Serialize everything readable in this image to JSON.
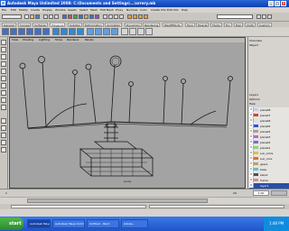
{
  "window": {
    "title": "Autodesk Maya Unlimited 2008: C:\\Documents and Settings\\...\\orrery.mb"
  },
  "menubar": {
    "items": [
      "File",
      "Edit",
      "Modify",
      "Create",
      "Display",
      "Window",
      "Assets",
      "Select",
      "Mesh",
      "Edit Mesh",
      "Proxy",
      "Normals",
      "Color",
      "Create UVs",
      "Edit UVs",
      "Help"
    ]
  },
  "shelf": {
    "tabs": [
      "General",
      "Curves",
      "Surfaces",
      "Polygons",
      "Subdivs",
      "Deformation",
      "Animation",
      "Dynamics",
      "Rendering",
      "PaintEffects",
      "Toon",
      "Muscle",
      "Fluids",
      "Fur",
      "Hair",
      "Cloth",
      "Custom"
    ]
  },
  "viewport": {
    "menu": [
      "View",
      "Shading",
      "Lighting",
      "Show",
      "Renderer",
      "Panels"
    ],
    "camera_label": "persp"
  },
  "layers": [
    {
      "name": "planet8",
      "color": "#c0d0e0"
    },
    {
      "name": "planet7",
      "color": "#d04040"
    },
    {
      "name": "planet6",
      "color": "#e0e0e0"
    },
    {
      "name": "planet5",
      "color": "#3050d0"
    },
    {
      "name": "planet4",
      "color": "#a0a0a0"
    },
    {
      "name": "planet3",
      "color": "#d060c0"
    },
    {
      "name": "planet2",
      "color": "#7070d0"
    },
    {
      "name": "planet1",
      "color": "#90d090"
    },
    {
      "name": "sun_arms",
      "color": "#e0c040"
    },
    {
      "name": "sun_core",
      "color": "#e07020"
    },
    {
      "name": "gears",
      "color": "#c0a060"
    },
    {
      "name": "base",
      "color": "#60c0d0"
    },
    {
      "name": "stand",
      "color": "#505050"
    },
    {
      "name": "frame",
      "color": "#d09090"
    },
    {
      "name": "layer1",
      "color": "#2a4fa8"
    }
  ],
  "channelbox": {
    "labels": [
      "Channels",
      "Object",
      "Layers",
      "Options",
      "Help"
    ]
  },
  "timeslider": {
    "start": "1",
    "end": "24",
    "current": "1.00"
  },
  "taskbar": {
    "start_label": "start",
    "items": [
      "Autodesk Maya...",
      "Autodesk Maya Unlim...",
      "Untitled - Paint",
      "Adobe..."
    ],
    "clock": "1:48 PM"
  }
}
